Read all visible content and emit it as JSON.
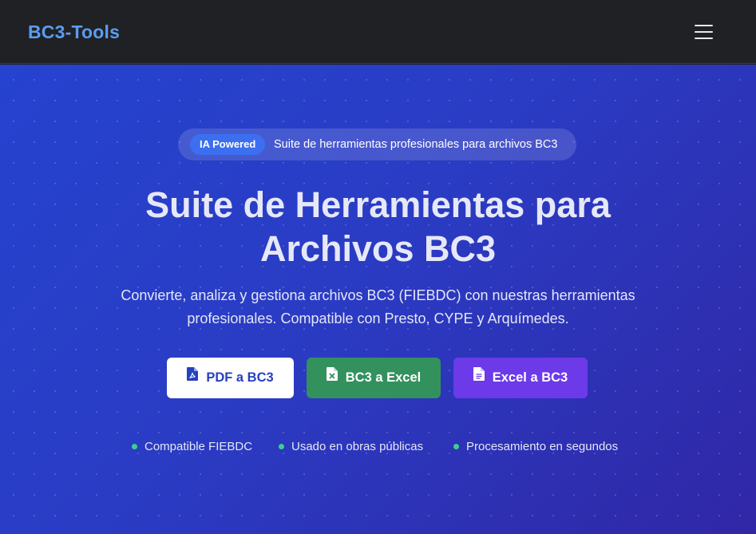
{
  "navbar": {
    "brand": "BC3-Tools",
    "menu_icon": "hamburger-menu-icon"
  },
  "hero": {
    "badge": "IA Powered",
    "badge_text": "Suite de herramientas profesionales para archivos BC3",
    "title_line1": "Suite de Herramientas para",
    "title_line2": "Archivos BC3",
    "subtitle_line1": "Convierte, analiza y gestiona archivos BC3 (FIEBDC) con nuestras herramientas",
    "subtitle_line2": "profesionales. Compatible con Presto, CYPE y Arquímedes.",
    "buttons": [
      {
        "label": "PDF a BC3",
        "icon": "pdf-file-icon"
      },
      {
        "label": "BC3 a Excel",
        "icon": "excel-file-icon"
      },
      {
        "label": "Excel a BC3",
        "icon": "document-file-icon"
      }
    ],
    "features": [
      "Compatible FIEBDC",
      "Usado en obras públicas",
      "Procesamiento en segundos"
    ]
  },
  "colors": {
    "brand": "#5b9cf0",
    "hero_start": "#2543cf",
    "hero_end": "#3027a6",
    "badge": "#3b6ff0",
    "excel_button": "#33915e",
    "xls_button": "#6c3ae8",
    "feature_dot": "#3dd08a"
  }
}
